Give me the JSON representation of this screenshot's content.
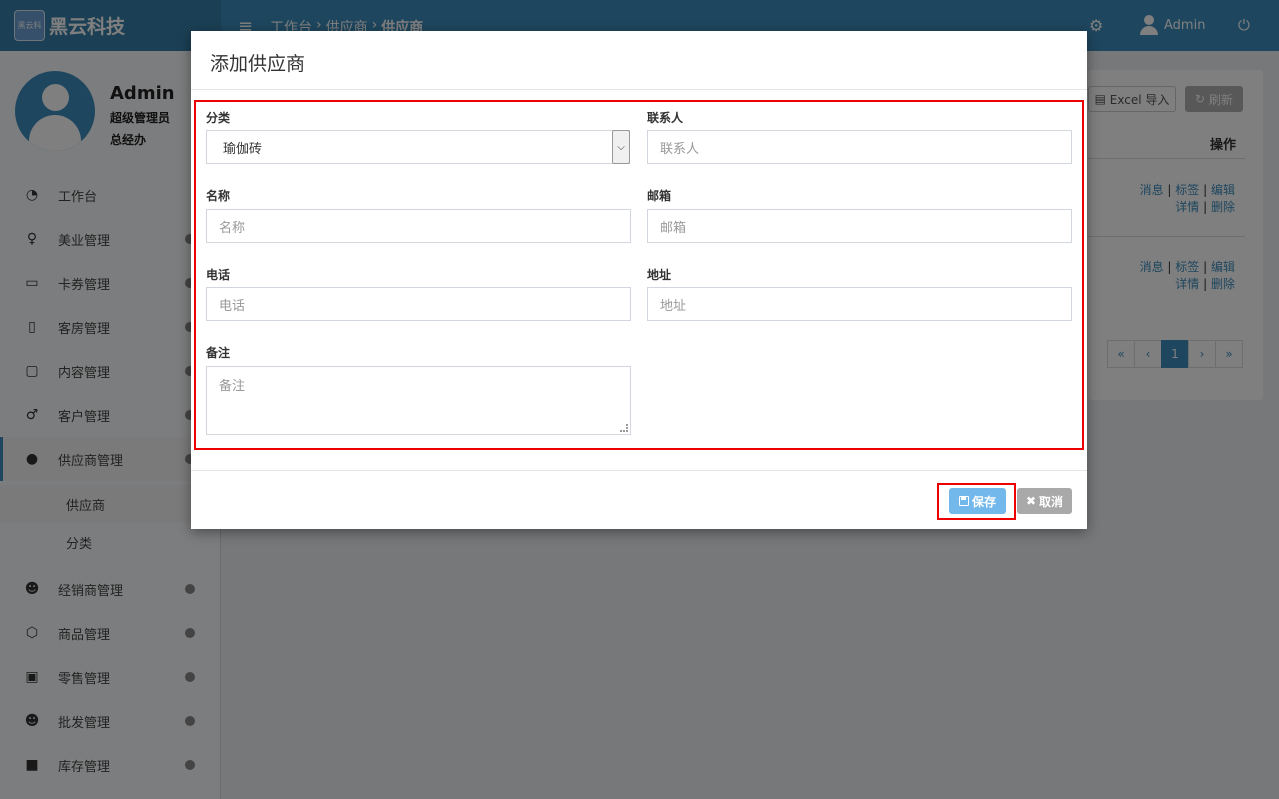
{
  "header": {
    "brand": "黑云科技",
    "logo_badge": "黑云科",
    "breadcrumb": [
      "工作台",
      "供应商",
      "供应商"
    ],
    "breadcrumb_sep": "›",
    "user": "Admin"
  },
  "profile": {
    "name": "Admin",
    "role": "超级管理员",
    "dept": "总经办"
  },
  "sidebar": {
    "items": [
      {
        "label": "工作台",
        "icon": "dashboard-icon"
      },
      {
        "label": "美业管理",
        "icon": "person-icon"
      },
      {
        "label": "卡券管理",
        "icon": "card-icon"
      },
      {
        "label": "客房管理",
        "icon": "building-icon"
      },
      {
        "label": "内容管理",
        "icon": "file-icon"
      },
      {
        "label": "客户管理",
        "icon": "male-icon"
      },
      {
        "label": "供应商管理",
        "icon": "user-icon"
      },
      {
        "label": "经销商管理",
        "icon": "users-icon"
      },
      {
        "label": "商品管理",
        "icon": "cubes-icon"
      },
      {
        "label": "零售管理",
        "icon": "money-icon"
      },
      {
        "label": "批发管理",
        "icon": "group-icon"
      },
      {
        "label": "库存管理",
        "icon": "archive-icon"
      }
    ],
    "subitems": [
      {
        "label": "供应商"
      },
      {
        "label": "分类"
      }
    ]
  },
  "background": {
    "excel_import": "Excel 导入",
    "refresh": "刷新",
    "column_header": "操作",
    "row_actions": [
      {
        "line1": [
          "消息",
          "标签",
          "编辑"
        ],
        "line2": [
          "详情",
          "删除"
        ]
      },
      {
        "line1": [
          "消息",
          "标签",
          "编辑"
        ],
        "line2": [
          "详情",
          "删除"
        ]
      }
    ],
    "pager": [
      "«",
      "‹",
      "1",
      "›",
      "»"
    ]
  },
  "modal": {
    "title": "添加供应商",
    "fields": {
      "category": {
        "label": "分类",
        "value": "瑜伽砖"
      },
      "contact": {
        "label": "联系人",
        "placeholder": "联系人"
      },
      "name": {
        "label": "名称",
        "placeholder": "名称"
      },
      "email": {
        "label": "邮箱",
        "placeholder": "邮箱"
      },
      "phone": {
        "label": "电话",
        "placeholder": "电话"
      },
      "address": {
        "label": "地址",
        "placeholder": "地址"
      },
      "remark": {
        "label": "备注",
        "placeholder": "备注"
      }
    },
    "save_label": "保存",
    "cancel_label": "取消"
  },
  "colors": {
    "header_blue": "#3c8dbc",
    "brand_blue": "#367fa9",
    "highlight_red": "#ee0000",
    "save_button": "#73b8ea",
    "cancel_button": "#a9a9a9"
  }
}
